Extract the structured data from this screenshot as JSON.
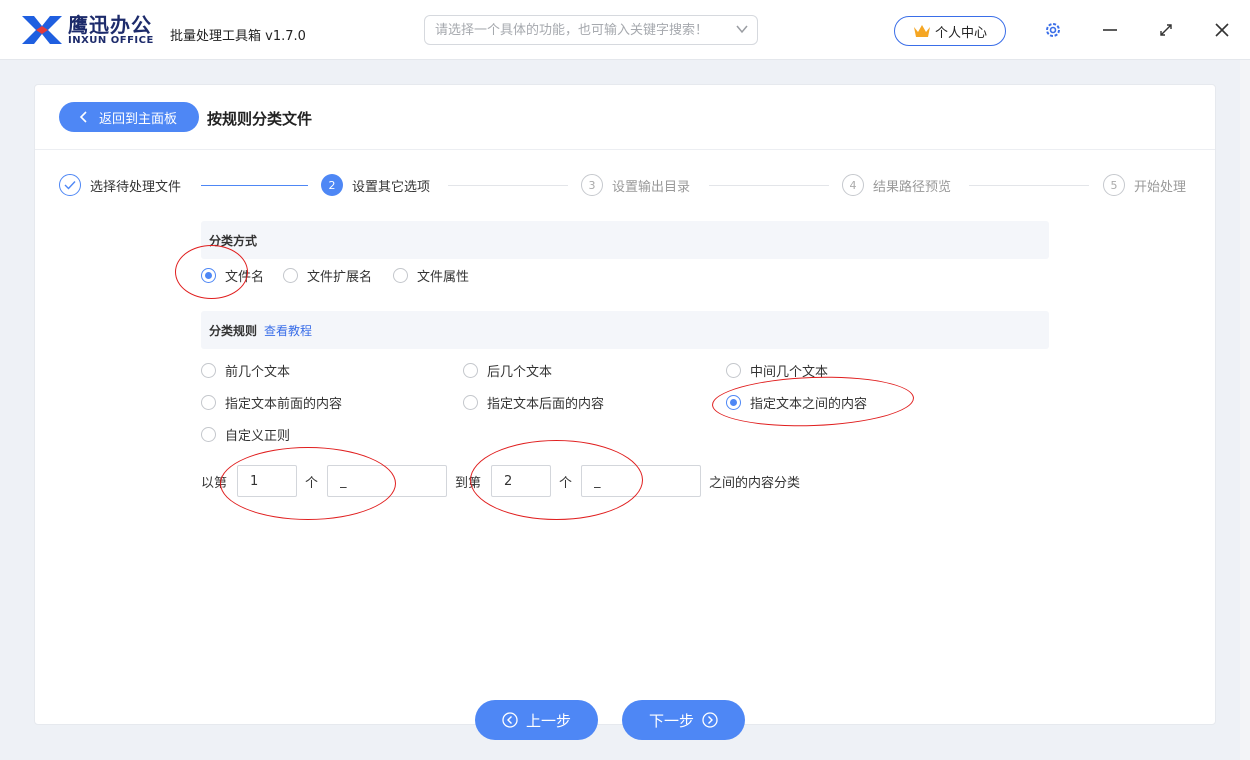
{
  "header": {
    "brand_cn": "鹰迅办公",
    "brand_en": "INXUN OFFICE",
    "app_title": "批量处理工具箱 v1.7.0",
    "search_placeholder": "请选择一个具体的功能，也可输入关键字搜索！",
    "personal_center": "个人中心",
    "icons": [
      "logo-icon",
      "chevron-down-icon",
      "crown-icon",
      "gear-icon",
      "minimize-icon",
      "maximize-icon",
      "close-icon"
    ]
  },
  "page": {
    "back_label": "返回到主面板",
    "title": "按规则分类文件"
  },
  "steps": [
    {
      "num": "✓",
      "label": "选择待处理文件",
      "state": "done"
    },
    {
      "num": "2",
      "label": "设置其它选项",
      "state": "active"
    },
    {
      "num": "3",
      "label": "设置输出目录",
      "state": "todo"
    },
    {
      "num": "4",
      "label": "结果路径预览",
      "state": "todo"
    },
    {
      "num": "5",
      "label": "开始处理",
      "state": "todo"
    }
  ],
  "classify_method": {
    "heading": "分类方式",
    "options": [
      {
        "label": "文件名",
        "checked": true
      },
      {
        "label": "文件扩展名",
        "checked": false
      },
      {
        "label": "文件属性",
        "checked": false
      }
    ]
  },
  "classify_rule": {
    "heading": "分类规则",
    "tutorial_link": "查看教程",
    "options": [
      {
        "label": "前几个文本",
        "checked": false
      },
      {
        "label": "后几个文本",
        "checked": false
      },
      {
        "label": "中间几个文本",
        "checked": false
      },
      {
        "label": "指定文本前面的内容",
        "checked": false
      },
      {
        "label": "指定文本后面的内容",
        "checked": false
      },
      {
        "label": "指定文本之间的内容",
        "checked": true
      },
      {
        "label": "自定义正则",
        "checked": false
      }
    ]
  },
  "rule_sentence": {
    "prefix": "以第",
    "first_index": "1",
    "unit1": "个",
    "first_text": "_",
    "middle": "到第",
    "second_index": "2",
    "unit2": "个",
    "second_text": "_",
    "suffix": "之间的内容分类"
  },
  "nav": {
    "prev_label": "上一步",
    "next_label": "下一步"
  },
  "colors": {
    "accent": "#4e87f5",
    "annotation": "#e01e1e",
    "brand": "#1d2b6b"
  }
}
